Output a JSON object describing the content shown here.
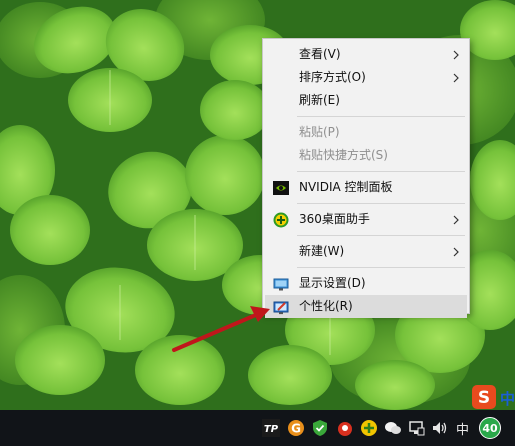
{
  "context_menu": {
    "items": [
      {
        "label": "查看(V)",
        "submenu": true
      },
      {
        "label": "排序方式(O)",
        "submenu": true
      },
      {
        "label": "刷新(E)"
      },
      {
        "label": "粘贴(P)",
        "disabled": true
      },
      {
        "label": "粘贴快捷方式(S)",
        "disabled": true
      },
      {
        "label": "NVIDIA 控制面板",
        "icon": "nvidia-icon"
      },
      {
        "label": "360桌面助手",
        "icon": "360-icon",
        "submenu": true
      },
      {
        "label": "新建(W)",
        "submenu": true
      },
      {
        "label": "显示设置(D)",
        "icon": "display-icon"
      },
      {
        "label": "个性化(R)",
        "icon": "personalize-icon",
        "highlighted": true
      }
    ]
  },
  "taskbar": {
    "language": "中",
    "notification_count": "40",
    "ime_badge_char": "中"
  },
  "colors": {
    "accent_arrow": "#c0161b",
    "menu_bg": "#f2f2f2",
    "highlight": "#dcdcdc",
    "taskbar_bg": "#111418"
  }
}
